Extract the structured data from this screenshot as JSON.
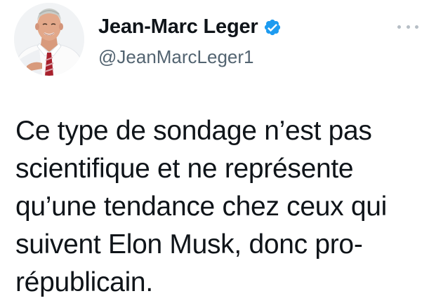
{
  "author": {
    "display_name": "Jean-Marc Leger",
    "handle": "@JeanMarcLeger1",
    "verified": true,
    "avatar_icon": "profile-photo"
  },
  "menu": {
    "icon": "more-horizontal-icon"
  },
  "tweet": {
    "lines": [
      "Ce type de sondage n’est pas",
      "scientifique et ne représente",
      "qu’une tendance chez ceux qui",
      "suivent Elon Musk, donc pro-",
      "républicain."
    ]
  },
  "colors": {
    "verified_badge": "#1d9bf0",
    "text_primary": "#0f1419",
    "text_secondary": "#536471",
    "menu_dots": "#b6bec5"
  }
}
